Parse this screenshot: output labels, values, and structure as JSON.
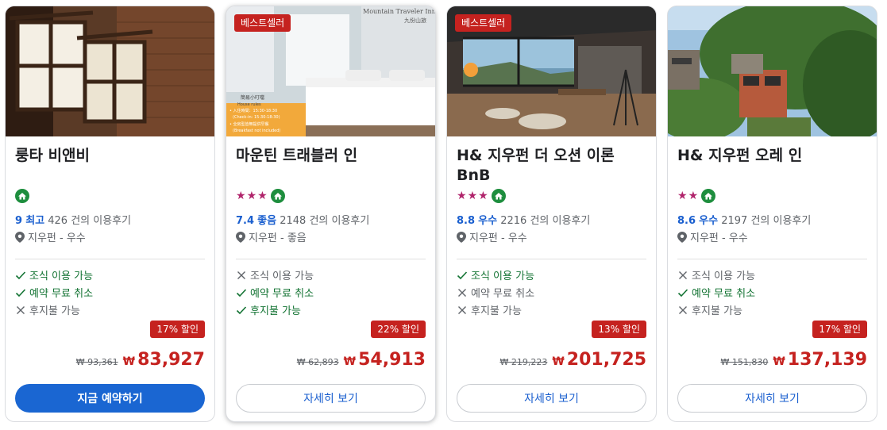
{
  "hotels": [
    {
      "badge": "",
      "name": "룽타 비앤비",
      "stars": 0,
      "score": "9",
      "grade": "최고",
      "reviews": "426 건의 이용후기",
      "location": "지우펀 - 우수",
      "features": [
        {
          "label": "조식 이용 가능",
          "available": true
        },
        {
          "label": "예약 무료 취소",
          "available": true
        },
        {
          "label": "후지불 가능",
          "available": false
        }
      ],
      "discount": "17% 할인",
      "old_price": "₩ 93,361",
      "currency": "₩",
      "price": "83,927",
      "button": "지금 예약하기",
      "button_style": "primary"
    },
    {
      "badge": "베스트셀러",
      "name": "마운틴 트래블러 인",
      "stars": 3,
      "score": "7.4",
      "grade": "좋음",
      "reviews": "2148 건의 이용후기",
      "location": "지우펀 - 좋음",
      "features": [
        {
          "label": "조식 이용 가능",
          "available": false
        },
        {
          "label": "예약 무료 취소",
          "available": true
        },
        {
          "label": "후지불 가능",
          "available": true
        }
      ],
      "discount": "22% 할인",
      "old_price": "₩ 62,893",
      "currency": "₩",
      "price": "54,913",
      "button": "자세히 보기",
      "button_style": "outline",
      "photo_text": {
        "sign_top": "Mountain Traveler Inn",
        "sign_sub": "九份山旅",
        "panel_title": "簡易小叮噹",
        "panel_sub": "House rules",
        "line1": "• 入住時間：15:30-18:30",
        "line2": "(Check-in: 15:30-18:30)",
        "line3": "• 全房型皆無提供早餐",
        "line4": "(Breakfast not included)"
      }
    },
    {
      "badge": "베스트셀러",
      "name": "H& 지우펀 더 오션 이론 BnB",
      "stars": 3,
      "score": "8.8",
      "grade": "우수",
      "reviews": "2216 건의 이용후기",
      "location": "지우펀 - 우수",
      "features": [
        {
          "label": "조식 이용 가능",
          "available": true
        },
        {
          "label": "예약 무료 취소",
          "available": false
        },
        {
          "label": "후지불 가능",
          "available": false
        }
      ],
      "discount": "13% 할인",
      "old_price": "₩ 219,223",
      "currency": "₩",
      "price": "201,725",
      "button": "자세히 보기",
      "button_style": "outline"
    },
    {
      "badge": "",
      "name": "H& 지우펀 오레 인",
      "stars": 2,
      "score": "8.6",
      "grade": "우수",
      "reviews": "2197 건의 이용후기",
      "location": "지우펀 - 우수",
      "features": [
        {
          "label": "조식 이용 가능",
          "available": false
        },
        {
          "label": "예약 무료 취소",
          "available": true
        },
        {
          "label": "후지불 가능",
          "available": false
        }
      ],
      "discount": "17% 할인",
      "old_price": "₩ 151,830",
      "currency": "₩",
      "price": "137,139",
      "button": "자세히 보기",
      "button_style": "outline"
    }
  ],
  "colors": {
    "accent_blue": "#1a66d2",
    "discount_red": "#c5221f",
    "star_color": "#b0246b",
    "available_green": "#137333"
  }
}
